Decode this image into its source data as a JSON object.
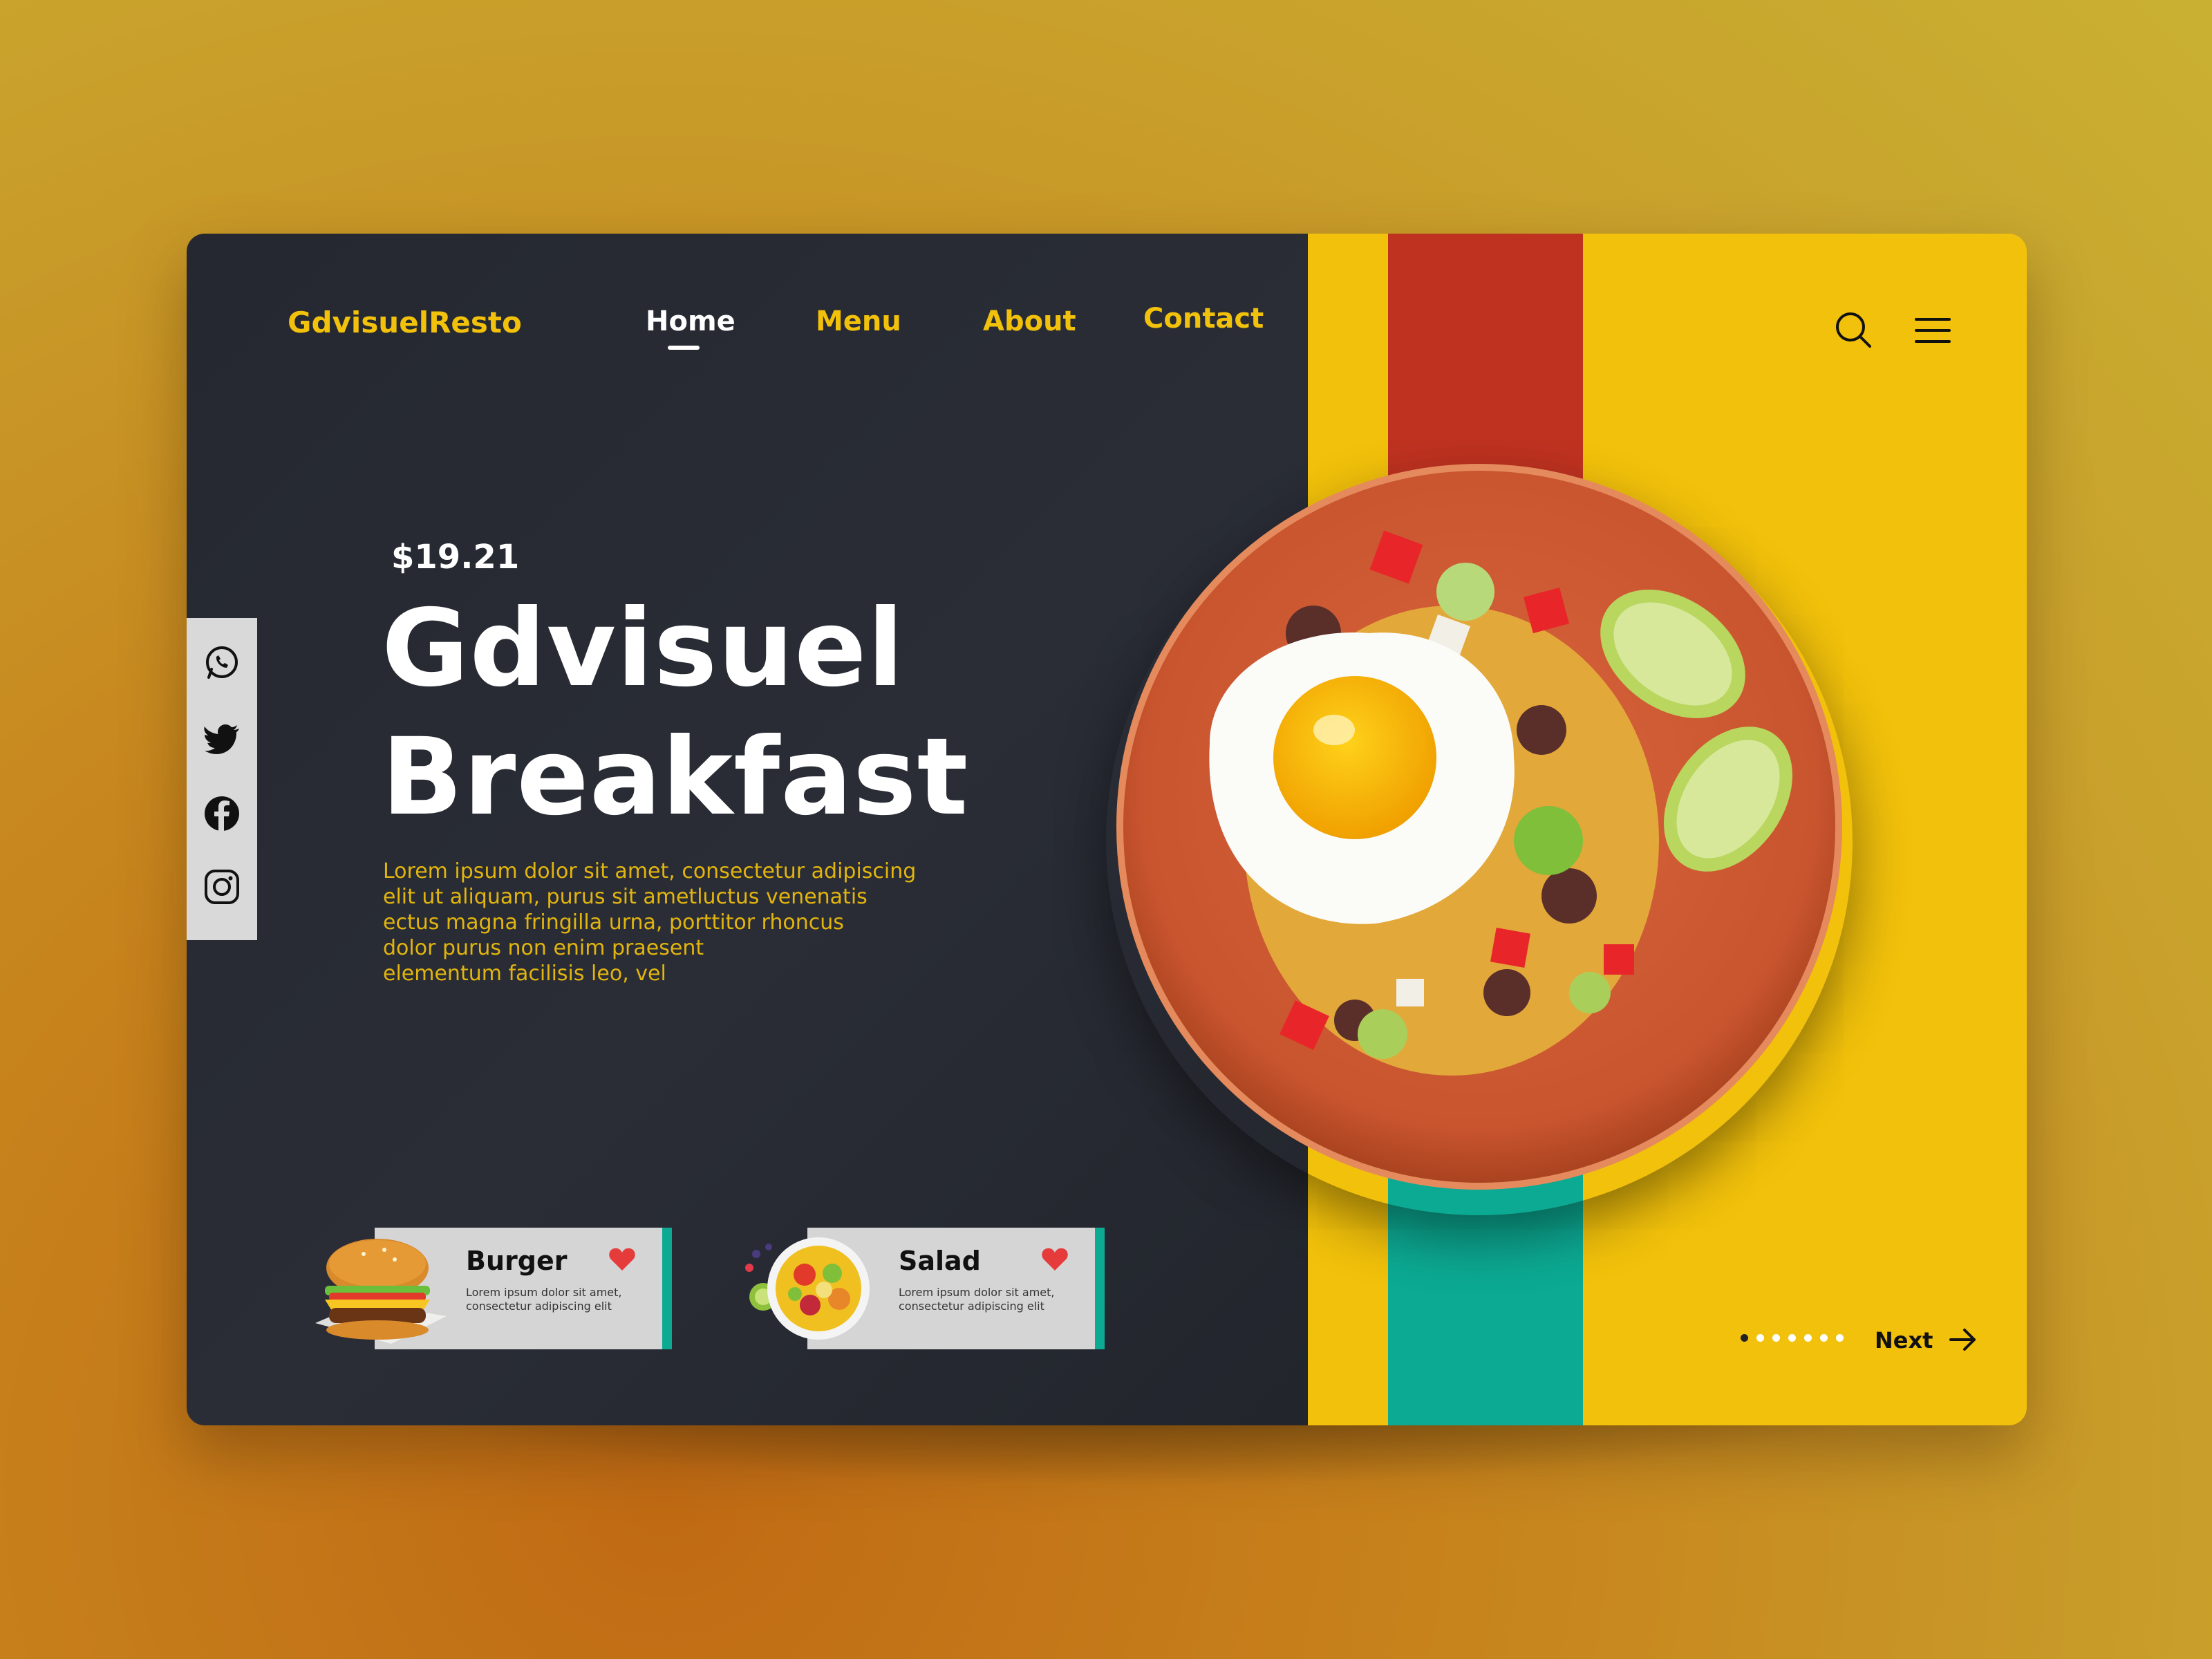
{
  "brand": {
    "logo": "GdvisuelResto"
  },
  "nav": {
    "items": [
      {
        "label": "Home",
        "active": true
      },
      {
        "label": "Menu",
        "active": false
      },
      {
        "label": "About",
        "active": false
      },
      {
        "label": "Contact",
        "active": false
      }
    ]
  },
  "header_icons": [
    "search-icon",
    "hamburger-menu-icon"
  ],
  "social": [
    "whatsapp-icon",
    "twitter-icon",
    "facebook-icon",
    "instagram-icon"
  ],
  "hero": {
    "price": "$19.21",
    "title_line1": "Gdvisuel",
    "title_line2": "Breakfast",
    "description": "Lorem ipsum dolor sit amet, consectetur adipiscing\nelit ut aliquam, purus sit ametluctus venenatis\nectus magna fringilla urna, porttitor rhoncus\n dolor purus non enim praesent\nelementum facilisis leo, vel"
  },
  "cards": [
    {
      "title": "Burger",
      "desc": "Lorem ipsum dolor sit amet,\nconsectetur adipiscing elit",
      "favorite": true
    },
    {
      "title": "Salad",
      "desc": "Lorem ipsum dolor sit amet,\nconsectetur adipiscing elit",
      "favorite": true
    }
  ],
  "pager": {
    "total_slides": 7,
    "current_slide": 1,
    "next_label": "Next"
  },
  "colors": {
    "dark": "#272a32",
    "yellow": "#f2c10b",
    "red": "#bf3220",
    "teal": "#0caa93",
    "heart": "#e63b3b"
  }
}
